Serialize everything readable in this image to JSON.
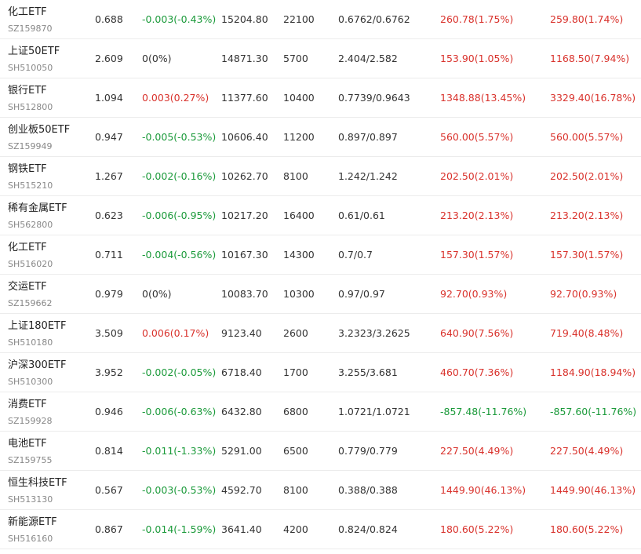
{
  "colors": {
    "up": "#d9322c",
    "down": "#1b9a3a",
    "flat": "#333333"
  },
  "rows": [
    {
      "name": "化工ETF",
      "code": "SZ159870",
      "price": "0.688",
      "change": "-0.003(-0.43%)",
      "change_dir": "down",
      "amount": "15204.80",
      "volume": "22100",
      "range": "0.6762/0.6762",
      "flow1": "260.78(1.75%)",
      "flow1_dir": "up",
      "flow2": "259.80(1.74%)",
      "flow2_dir": "up"
    },
    {
      "name": "上证50ETF",
      "code": "SH510050",
      "price": "2.609",
      "change": "0(0%)",
      "change_dir": "flat",
      "amount": "14871.30",
      "volume": "5700",
      "range": "2.404/2.582",
      "flow1": "153.90(1.05%)",
      "flow1_dir": "up",
      "flow2": "1168.50(7.94%)",
      "flow2_dir": "up"
    },
    {
      "name": "银行ETF",
      "code": "SH512800",
      "price": "1.094",
      "change": "0.003(0.27%)",
      "change_dir": "up",
      "amount": "11377.60",
      "volume": "10400",
      "range": "0.7739/0.9643",
      "flow1": "1348.88(13.45%)",
      "flow1_dir": "up",
      "flow2": "3329.40(16.78%)",
      "flow2_dir": "up"
    },
    {
      "name": "创业板50ETF",
      "code": "SZ159949",
      "price": "0.947",
      "change": "-0.005(-0.53%)",
      "change_dir": "down",
      "amount": "10606.40",
      "volume": "11200",
      "range": "0.897/0.897",
      "flow1": "560.00(5.57%)",
      "flow1_dir": "up",
      "flow2": "560.00(5.57%)",
      "flow2_dir": "up"
    },
    {
      "name": "钢铁ETF",
      "code": "SH515210",
      "price": "1.267",
      "change": "-0.002(-0.16%)",
      "change_dir": "down",
      "amount": "10262.70",
      "volume": "8100",
      "range": "1.242/1.242",
      "flow1": "202.50(2.01%)",
      "flow1_dir": "up",
      "flow2": "202.50(2.01%)",
      "flow2_dir": "up"
    },
    {
      "name": "稀有金属ETF",
      "code": "SH562800",
      "price": "0.623",
      "change": "-0.006(-0.95%)",
      "change_dir": "down",
      "amount": "10217.20",
      "volume": "16400",
      "range": "0.61/0.61",
      "flow1": "213.20(2.13%)",
      "flow1_dir": "up",
      "flow2": "213.20(2.13%)",
      "flow2_dir": "up"
    },
    {
      "name": "化工ETF",
      "code": "SH516020",
      "price": "0.711",
      "change": "-0.004(-0.56%)",
      "change_dir": "down",
      "amount": "10167.30",
      "volume": "14300",
      "range": "0.7/0.7",
      "flow1": "157.30(1.57%)",
      "flow1_dir": "up",
      "flow2": "157.30(1.57%)",
      "flow2_dir": "up"
    },
    {
      "name": "交运ETF",
      "code": "SZ159662",
      "price": "0.979",
      "change": "0(0%)",
      "change_dir": "flat",
      "amount": "10083.70",
      "volume": "10300",
      "range": "0.97/0.97",
      "flow1": "92.70(0.93%)",
      "flow1_dir": "up",
      "flow2": "92.70(0.93%)",
      "flow2_dir": "up"
    },
    {
      "name": "上证180ETF",
      "code": "SH510180",
      "price": "3.509",
      "change": "0.006(0.17%)",
      "change_dir": "up",
      "amount": "9123.40",
      "volume": "2600",
      "range": "3.2323/3.2625",
      "flow1": "640.90(7.56%)",
      "flow1_dir": "up",
      "flow2": "719.40(8.48%)",
      "flow2_dir": "up"
    },
    {
      "name": "沪深300ETF",
      "code": "SH510300",
      "price": "3.952",
      "change": "-0.002(-0.05%)",
      "change_dir": "down",
      "amount": "6718.40",
      "volume": "1700",
      "range": "3.255/3.681",
      "flow1": "460.70(7.36%)",
      "flow1_dir": "up",
      "flow2": "1184.90(18.94%)",
      "flow2_dir": "up"
    },
    {
      "name": "消费ETF",
      "code": "SZ159928",
      "price": "0.946",
      "change": "-0.006(-0.63%)",
      "change_dir": "down",
      "amount": "6432.80",
      "volume": "6800",
      "range": "1.0721/1.0721",
      "flow1": "-857.48(-11.76%)",
      "flow1_dir": "down",
      "flow2": "-857.60(-11.76%)",
      "flow2_dir": "down"
    },
    {
      "name": "电池ETF",
      "code": "SZ159755",
      "price": "0.814",
      "change": "-0.011(-1.33%)",
      "change_dir": "down",
      "amount": "5291.00",
      "volume": "6500",
      "range": "0.779/0.779",
      "flow1": "227.50(4.49%)",
      "flow1_dir": "up",
      "flow2": "227.50(4.49%)",
      "flow2_dir": "up"
    },
    {
      "name": "恒生科技ETF",
      "code": "SH513130",
      "price": "0.567",
      "change": "-0.003(-0.53%)",
      "change_dir": "down",
      "amount": "4592.70",
      "volume": "8100",
      "range": "0.388/0.388",
      "flow1": "1449.90(46.13%)",
      "flow1_dir": "up",
      "flow2": "1449.90(46.13%)",
      "flow2_dir": "up"
    },
    {
      "name": "新能源ETF",
      "code": "SH516160",
      "price": "0.867",
      "change": "-0.014(-1.59%)",
      "change_dir": "down",
      "amount": "3641.40",
      "volume": "4200",
      "range": "0.824/0.824",
      "flow1": "180.60(5.22%)",
      "flow1_dir": "up",
      "flow2": "180.60(5.22%)",
      "flow2_dir": "up"
    }
  ]
}
